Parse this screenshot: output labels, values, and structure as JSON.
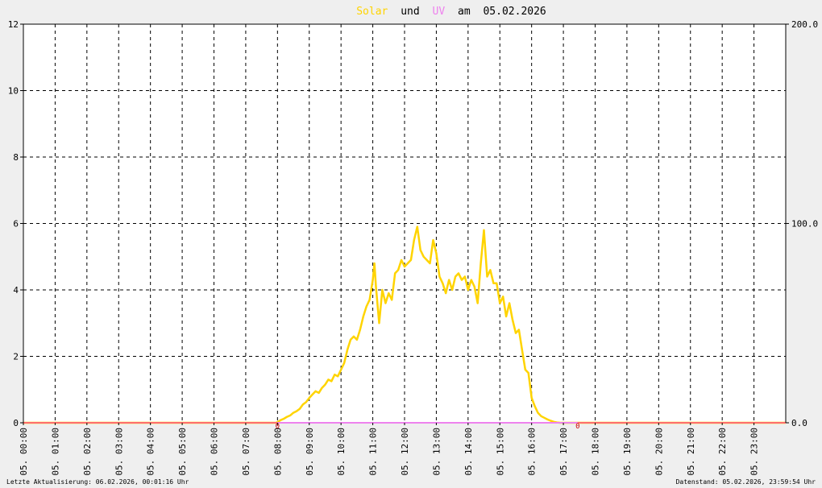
{
  "chart_data": {
    "type": "line",
    "title": {
      "solar": "Solar",
      "und": "und",
      "uv": "UV",
      "am": "am",
      "date": "05.02.2026"
    },
    "colors": {
      "solar": "#ffd400",
      "uv": "#ee82ee",
      "zero_line": "#ff6e6e",
      "zero_marker": "#cc0000",
      "grid": "#000000",
      "plot_bg": "#ffffff",
      "page_bg": "#efefef"
    },
    "x_ticks": [
      "05. 00:00",
      "05. 01:00",
      "05. 02:00",
      "05. 03:00",
      "05. 04:00",
      "05. 05:00",
      "05. 06:00",
      "05. 07:00",
      "05. 08:00",
      "05. 09:00",
      "05. 10:00",
      "05. 11:00",
      "05. 12:00",
      "05. 13:00",
      "05. 14:00",
      "05. 15:00",
      "05. 16:00",
      "05. 17:00",
      "05. 18:00",
      "05. 19:00",
      "05. 20:00",
      "05. 21:00",
      "05. 22:00",
      "05. 23:00"
    ],
    "xlim_hours": [
      0,
      24
    ],
    "y_left": {
      "ticks": [
        "0",
        "2",
        "4",
        "6",
        "8",
        "10",
        "12"
      ],
      "range": [
        0,
        12
      ]
    },
    "y_right": {
      "ticks": [
        "0.0",
        "100.0",
        "200.0"
      ],
      "range": [
        0,
        200
      ]
    },
    "grid": true,
    "zero_markers": [
      {
        "hour": 8.0,
        "label": "0"
      },
      {
        "hour": 17.45,
        "label": "0"
      }
    ],
    "series": [
      {
        "name": "Solar",
        "axis": "left",
        "x_hours": [
          0,
          7.95,
          8.0,
          8.1,
          8.2,
          8.3,
          8.4,
          8.5,
          8.6,
          8.7,
          8.8,
          8.9,
          9.0,
          9.1,
          9.2,
          9.3,
          9.4,
          9.5,
          9.6,
          9.7,
          9.8,
          9.9,
          10.0,
          10.1,
          10.2,
          10.3,
          10.4,
          10.5,
          10.6,
          10.7,
          10.8,
          10.9,
          11.0,
          11.05,
          11.1,
          11.2,
          11.3,
          11.4,
          11.5,
          11.6,
          11.7,
          11.8,
          11.9,
          12.0,
          12.1,
          12.2,
          12.3,
          12.4,
          12.5,
          12.6,
          12.7,
          12.8,
          12.9,
          13.0,
          13.1,
          13.2,
          13.3,
          13.4,
          13.5,
          13.6,
          13.7,
          13.8,
          13.9,
          14.0,
          14.1,
          14.2,
          14.3,
          14.4,
          14.5,
          14.6,
          14.7,
          14.8,
          14.9,
          15.0,
          15.1,
          15.2,
          15.3,
          15.4,
          15.5,
          15.6,
          15.7,
          15.8,
          15.9,
          16.0,
          16.1,
          16.2,
          16.3,
          16.4,
          16.5,
          16.6,
          16.7,
          16.8,
          16.9,
          17.0,
          17.1,
          17.2,
          17.3,
          17.4,
          24
        ],
        "y": [
          0,
          0,
          0.02,
          0.08,
          0.12,
          0.18,
          0.22,
          0.3,
          0.35,
          0.42,
          0.55,
          0.62,
          0.75,
          0.85,
          0.95,
          0.9,
          1.05,
          1.15,
          1.3,
          1.25,
          1.45,
          1.4,
          1.6,
          1.8,
          2.2,
          2.5,
          2.6,
          2.5,
          2.8,
          3.2,
          3.5,
          3.7,
          4.3,
          4.8,
          4.1,
          3.0,
          4.0,
          3.6,
          3.9,
          3.7,
          4.5,
          4.6,
          4.9,
          4.7,
          4.8,
          4.9,
          5.5,
          5.9,
          5.2,
          5.0,
          4.9,
          4.8,
          5.5,
          5.1,
          4.4,
          4.2,
          3.9,
          4.3,
          4.0,
          4.4,
          4.5,
          4.3,
          4.4,
          4.0,
          4.3,
          4.1,
          3.6,
          4.8,
          5.8,
          4.4,
          4.6,
          4.2,
          4.2,
          3.6,
          3.8,
          3.2,
          3.6,
          3.1,
          2.7,
          2.8,
          2.2,
          1.6,
          1.5,
          0.75,
          0.5,
          0.3,
          0.2,
          0.15,
          0.1,
          0.06,
          0.03,
          0.01,
          0,
          0,
          0,
          0,
          0,
          0,
          0
        ]
      },
      {
        "name": "UV",
        "axis": "right",
        "x_hours": [
          0,
          24
        ],
        "y": [
          0,
          0
        ]
      }
    ]
  },
  "footer": {
    "left": "Letzte Aktualisierung: 06.02.2026, 00:01:16 Uhr",
    "right": "Datenstand: 05.02.2026, 23:59:54 Uhr"
  }
}
